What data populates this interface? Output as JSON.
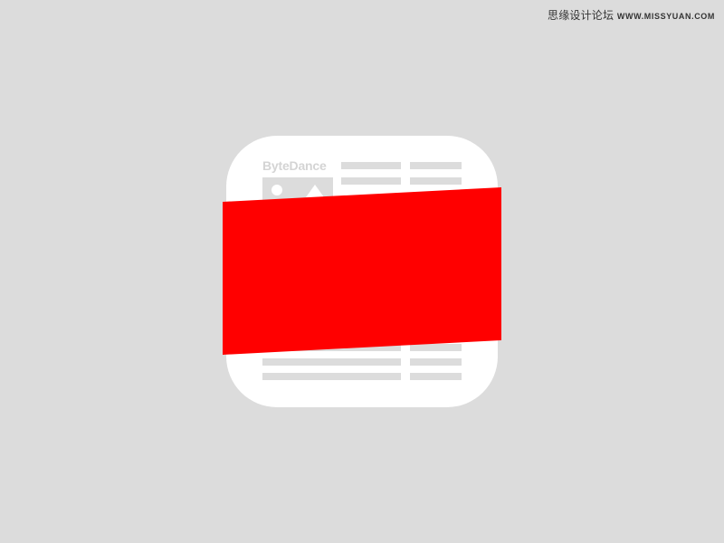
{
  "watermark": {
    "chinese": "思缘设计论坛",
    "url": "WWW.MISSYUAN.COM"
  },
  "icon": {
    "brand_text": "ByteDance"
  },
  "colors": {
    "background": "#dcdcdc",
    "icon_fill": "#ffffff",
    "placeholder_gray": "#dcdcdc",
    "band_red": "#ff0000"
  },
  "icons": {
    "image_placeholder": "image-icon"
  }
}
